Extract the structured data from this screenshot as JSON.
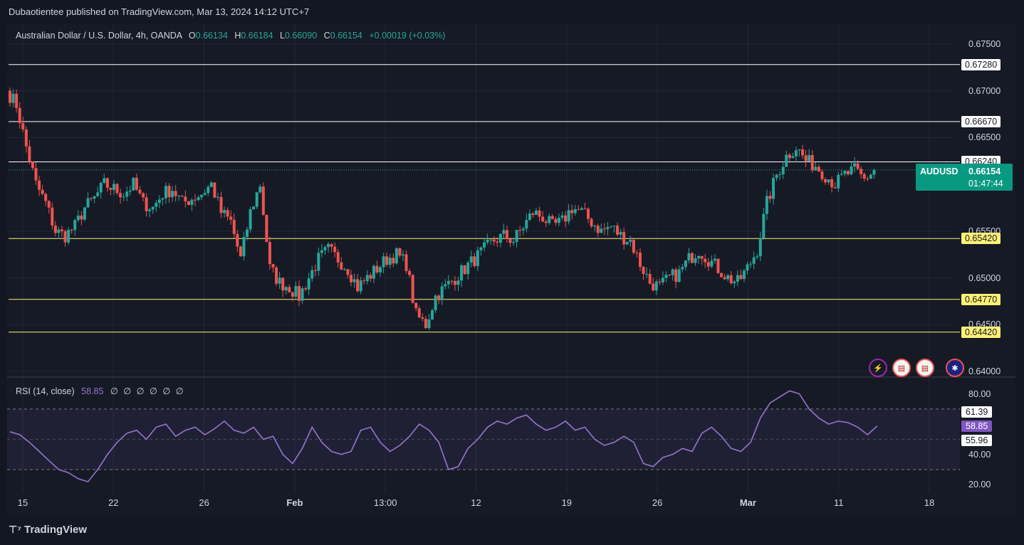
{
  "publisher": "Dubaotientee published on TradingView.com, Mar 13, 2024 14:12 UTC+7",
  "header": {
    "instrument": "Australian Dollar / U.S. Dollar, 4h, OANDA",
    "o_label": "O",
    "o": "0.66134",
    "h_label": "H",
    "h": "0.66184",
    "l_label": "L",
    "l": "0.66090",
    "c_label": "C",
    "c": "0.66154",
    "change": "+0.00019 (+0.03%)"
  },
  "rsi_header": {
    "label": "RSI (14, close)",
    "value": "58.85",
    "placeholders": "∅ ∅ ∅ ∅ ∅ ∅"
  },
  "current_badge": {
    "symbol": "AUDUSD",
    "price": "0.66154",
    "countdown": "01:47:44"
  },
  "footer": {
    "brand": "TradingView"
  },
  "colors": {
    "up": "#26a69a",
    "down": "#ef5350",
    "rsi": "#9575cd",
    "bg": "#161a25"
  },
  "icons": [
    "lightning-icon",
    "us-flag-icon",
    "us-flag-icon",
    "au-flag-icon"
  ],
  "chart_data": {
    "type": "candlestick",
    "symbol": "AUDUSD",
    "timeframe": "4h",
    "ylim": [
      0.64,
      0.6762
    ],
    "y_ticks": [
      "0.67500",
      "0.67000",
      "0.66500",
      "0.65500",
      "0.65000",
      "0.64500",
      "0.64000"
    ],
    "x_ticks": [
      {
        "label": "15",
        "bold": false
      },
      {
        "label": "22",
        "bold": false
      },
      {
        "label": "26",
        "bold": false
      },
      {
        "label": "Feb",
        "bold": true
      },
      {
        "label": "13:00",
        "bold": false
      },
      {
        "label": "12",
        "bold": false
      },
      {
        "label": "19",
        "bold": false
      },
      {
        "label": "26",
        "bold": false
      },
      {
        "label": "Mar",
        "bold": true
      },
      {
        "label": "11",
        "bold": false
      },
      {
        "label": "18",
        "bold": false
      }
    ],
    "white_levels": [
      "0.67280",
      "0.66670",
      "0.66240"
    ],
    "yellow_levels": [
      "0.65420",
      "0.64770",
      "0.64420"
    ],
    "close_path": [
      0.67,
      0.6685,
      0.664,
      0.66,
      0.658,
      0.655,
      0.6545,
      0.6555,
      0.6575,
      0.6585,
      0.66,
      0.6595,
      0.659,
      0.66,
      0.658,
      0.6575,
      0.659,
      0.6595,
      0.658,
      0.6585,
      0.659,
      0.66,
      0.657,
      0.656,
      0.652,
      0.657,
      0.66,
      0.651,
      0.6495,
      0.649,
      0.648,
      0.65,
      0.652,
      0.653,
      0.652,
      0.651,
      0.649,
      0.65,
      0.651,
      0.652,
      0.6525,
      0.6515,
      0.646,
      0.645,
      0.648,
      0.649,
      0.65,
      0.651,
      0.652,
      0.653,
      0.654,
      0.6545,
      0.654,
      0.6555,
      0.657,
      0.6565,
      0.6555,
      0.656,
      0.6575,
      0.657,
      0.656,
      0.655,
      0.6555,
      0.6545,
      0.654,
      0.6515,
      0.6495,
      0.649,
      0.65,
      0.6505,
      0.652,
      0.653,
      0.652,
      0.651,
      0.65,
      0.6495,
      0.651,
      0.653,
      0.658,
      0.661,
      0.663,
      0.664,
      0.6625,
      0.662,
      0.661,
      0.66,
      0.661,
      0.6615,
      0.6605,
      0.6615
    ],
    "rsi": {
      "value": 58.85,
      "levels": {
        "upper": 61.39,
        "middle": 55.96
      },
      "y_ticks": [
        "80.00",
        "40.00",
        "20.00"
      ],
      "band_top": 70,
      "band_bottom": 30,
      "ylim": [
        15,
        84
      ],
      "values": [
        55,
        53,
        48,
        42,
        36,
        30,
        28,
        24,
        22,
        30,
        40,
        48,
        54,
        56,
        50,
        58,
        60,
        52,
        56,
        58,
        53,
        57,
        62,
        56,
        54,
        58,
        50,
        52,
        40,
        34,
        44,
        58,
        48,
        42,
        40,
        42,
        56,
        58,
        48,
        42,
        46,
        52,
        60,
        56,
        48,
        30,
        32,
        44,
        50,
        58,
        62,
        60,
        64,
        66,
        60,
        56,
        58,
        62,
        56,
        58,
        50,
        46,
        48,
        52,
        48,
        34,
        32,
        38,
        40,
        44,
        42,
        54,
        58,
        52,
        44,
        42,
        48,
        64,
        74,
        78,
        82,
        80,
        70,
        64,
        60,
        62,
        61,
        58,
        53,
        58.85
      ]
    }
  }
}
